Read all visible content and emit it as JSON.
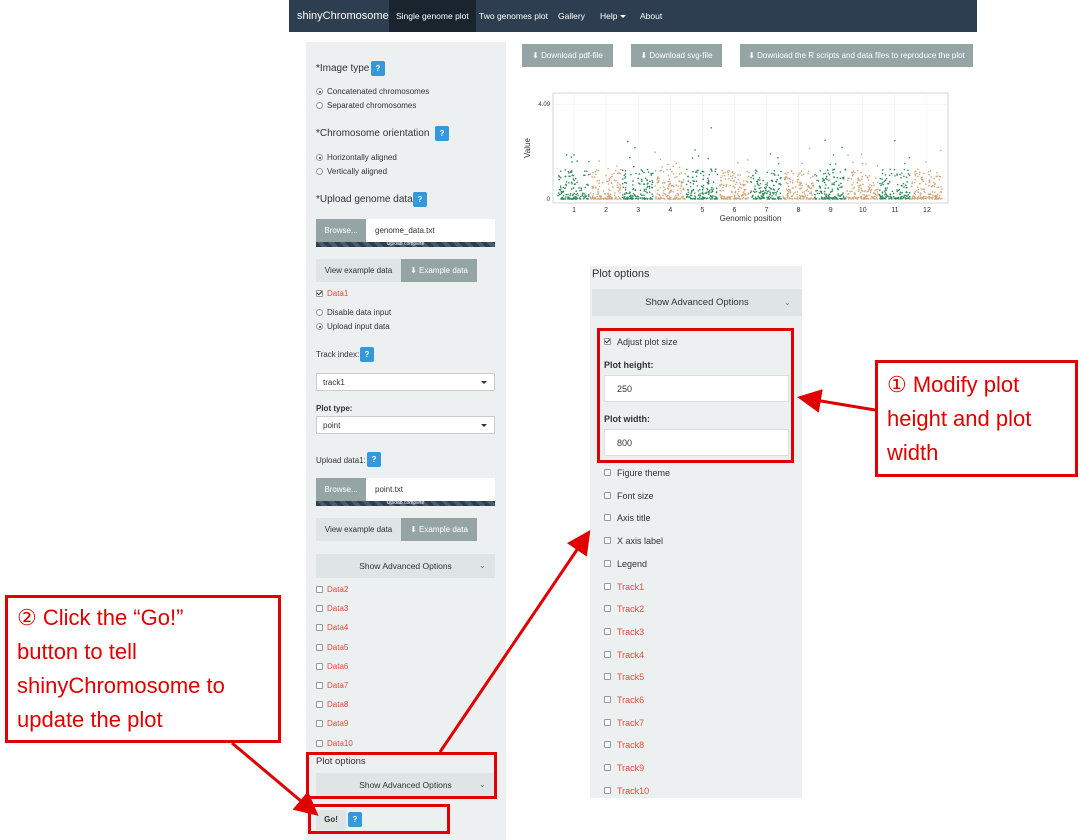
{
  "navbar": {
    "brand": "shinyChromosome",
    "items": [
      "Single genome plot",
      "Two genomes plot",
      "Gallery",
      "Help",
      "About"
    ]
  },
  "sidebar": {
    "image_type": {
      "label": "*Image type",
      "help": "?",
      "options": [
        "Concatenated chromosomes",
        "Separated chromosomes"
      ],
      "selected_index": 0
    },
    "orientation": {
      "label": "*Chromosome orientation",
      "help": "?",
      "options": [
        "Horizontally aligned",
        "Vertically aligned"
      ],
      "selected_index": 0
    },
    "upload_genome": {
      "label": "*Upload genome data",
      "help": "?",
      "browse": "Browse...",
      "file": "genome_data.txt",
      "progress": "Upload complete",
      "progress_pct": 100
    },
    "view_example": "View example data",
    "example_data": "Example data",
    "data1": {
      "label": "Data1",
      "checked": true,
      "options": [
        "Disable data input",
        "Upload input data"
      ],
      "selected_index": 1
    },
    "track_index": {
      "label": "Track index:",
      "help": "?",
      "value": "track1"
    },
    "plot_type": {
      "label": "Plot type:",
      "value": "point"
    },
    "upload_data1": {
      "label": "Upload data1:",
      "help": "?",
      "browse": "Browse...",
      "file": "point.txt",
      "progress": "Upload complete",
      "progress_pct": 100
    },
    "view_example2": "View example data",
    "example_data2": "Example data",
    "advanced": "Show Advanced Options",
    "data_items": [
      "Data2",
      "Data3",
      "Data4",
      "Data5",
      "Data6",
      "Data7",
      "Data8",
      "Data9",
      "Data10"
    ],
    "plot_options": {
      "title": "Plot options",
      "advanced": "Show Advanced Options"
    },
    "go": {
      "label": "Go!",
      "help": "?"
    }
  },
  "main": {
    "downloads": [
      "Download pdf-file",
      "Download svg-file",
      "Download the R scripts and data files to reproduce the plot"
    ]
  },
  "chart_data": {
    "type": "scatter",
    "title": "",
    "xlabel": "Genomic position",
    "ylabel": "Value",
    "yticks": [
      "0",
      "4.09"
    ],
    "ylim": [
      0,
      4.4
    ],
    "categories": [
      "1",
      "2",
      "3",
      "4",
      "5",
      "6",
      "7",
      "8",
      "9",
      "10",
      "11",
      "12"
    ],
    "series": [
      {
        "color": "#2e8b57",
        "chromosomes": [
          "1",
          "3",
          "5",
          "7",
          "9",
          "11"
        ]
      },
      {
        "color": "#d2a679",
        "chromosomes": [
          "2",
          "4",
          "6",
          "8",
          "10",
          "12"
        ]
      }
    ],
    "max_value": 4.09,
    "grid": true,
    "legend": "none"
  },
  "plot_options_panel": {
    "title": "Plot options",
    "advanced": "Show Advanced Options",
    "adjust_size": {
      "label": "Adjust plot size",
      "checked": true
    },
    "plot_height": {
      "label": "Plot height:",
      "value": "250"
    },
    "plot_width": {
      "label": "Plot width:",
      "value": "800"
    },
    "items": [
      "Figure theme",
      "Font size",
      "Axis title",
      "X axis label",
      "Legend"
    ],
    "tracks": [
      "Track1",
      "Track2",
      "Track3",
      "Track4",
      "Track5",
      "Track6",
      "Track7",
      "Track8",
      "Track9",
      "Track10"
    ]
  },
  "annotations": {
    "step1": [
      "① Modify plot",
      "height and plot",
      "width"
    ],
    "step2": [
      "② Click the “Go!”",
      "button to tell",
      "shinyChromosome to",
      "update the plot"
    ],
    "color": "#e00000"
  }
}
